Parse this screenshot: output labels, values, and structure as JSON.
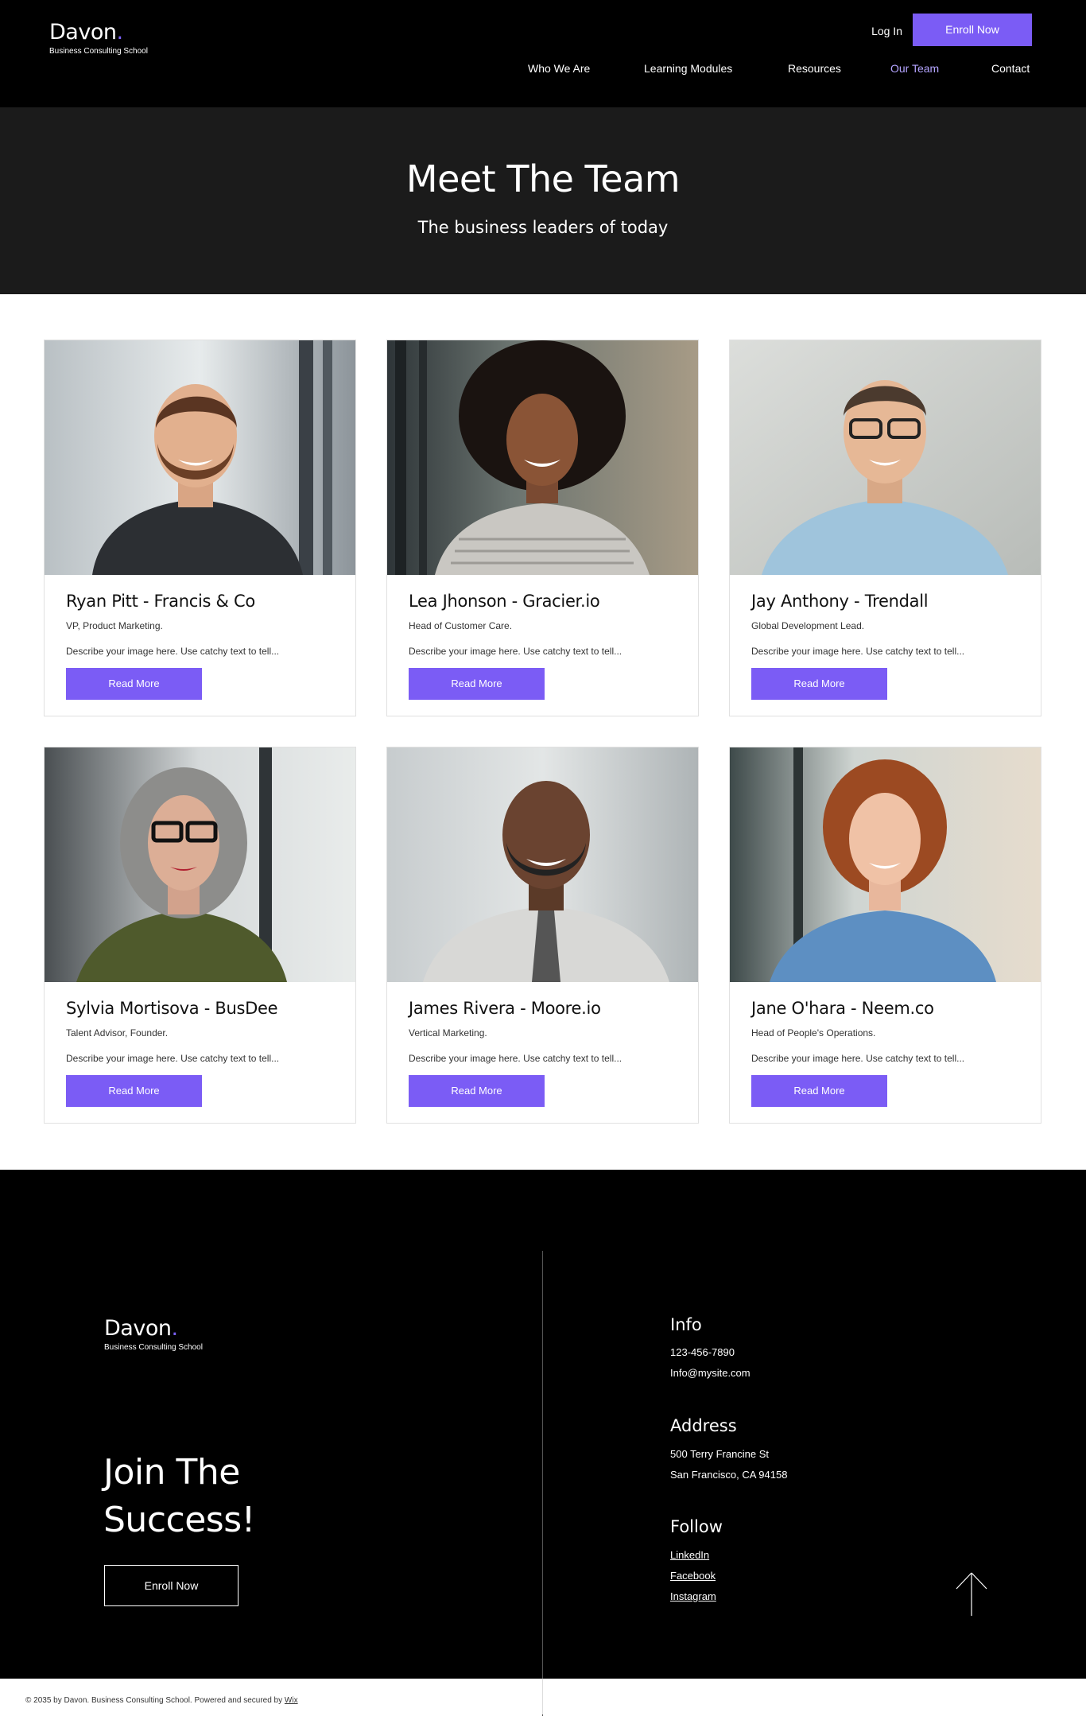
{
  "header": {
    "logo_name": "Davon",
    "logo_dot": ".",
    "logo_sub": "Business Consulting School",
    "login_label": "Log In",
    "enroll_label": "Enroll Now",
    "nav": [
      {
        "label": "Who We Are",
        "active": false
      },
      {
        "label": "Learning Modules",
        "active": false
      },
      {
        "label": "Resources",
        "active": false
      },
      {
        "label": "Our Team",
        "active": true
      },
      {
        "label": "Contact",
        "active": false
      }
    ]
  },
  "hero": {
    "title": "Meet The Team",
    "subtitle": "The business leaders of today"
  },
  "team": [
    {
      "name": "Ryan Pitt - Francis & Co",
      "role": "VP, Product Marketing.",
      "description": "Describe your image here. Use catchy text to tell...",
      "button": "Read More"
    },
    {
      "name": "Lea Jhonson - Gracier.io",
      "role": "Head of Customer Care.",
      "description": "Describe your image here. Use catchy text to tell...",
      "button": "Read More"
    },
    {
      "name": "Jay Anthony - Trendall",
      "role": "Global Development Lead.",
      "description": "Describe your image here. Use catchy text to tell...",
      "button": "Read More"
    },
    {
      "name": "Sylvia Mortisova - BusDee",
      "role": "Talent Advisor, Founder.",
      "description": "Describe your image here. Use catchy text to tell...",
      "button": "Read More"
    },
    {
      "name": "James Rivera - Moore.io",
      "role": "Vertical Marketing.",
      "description": "Describe your image here. Use catchy text to tell...",
      "button": "Read More"
    },
    {
      "name": "Jane O'hara - Neem.co",
      "role": "Head of People's Operations.",
      "description": "Describe your image here. Use catchy text to tell...",
      "button": "Read More"
    }
  ],
  "footer": {
    "logo_name": "Davon",
    "logo_dot": ".",
    "logo_sub": "Business Consulting School",
    "join_line1": "Join The",
    "join_line2": "Success!",
    "enroll_label": "Enroll Now",
    "info_heading": "Info",
    "phone": "123-456-7890",
    "email": "Info@mysite.com",
    "address_heading": "Address",
    "address_line1": "500 Terry Francine St",
    "address_line2": "San Francisco, CA 94158",
    "follow_heading": "Follow",
    "social": [
      "LinkedIn",
      "Facebook",
      "Instagram"
    ]
  },
  "bottom_bar": {
    "copyright": "© 2035 by Davon. Business Consulting School. Powered and secured by ",
    "wix_link": "Wix"
  },
  "colors": {
    "accent": "#7b5cf5",
    "nav_active": "#b4a4ff",
    "header_bg": "#000000",
    "hero_bg": "#1b1b1b"
  }
}
